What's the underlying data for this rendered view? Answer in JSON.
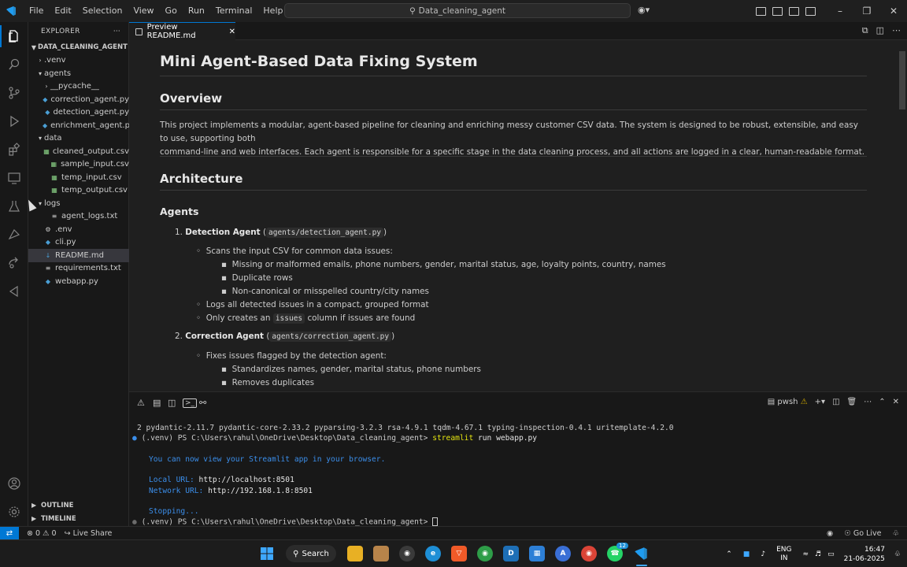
{
  "menu": [
    "File",
    "Edit",
    "Selection",
    "View",
    "Go",
    "Run",
    "Terminal",
    "Help"
  ],
  "search": {
    "text": "Data_cleaning_agent"
  },
  "explorer": {
    "header": "EXPLORER",
    "root": "DATA_CLEANING_AGENT",
    "items": [
      {
        "label": ".venv",
        "kind": "folder",
        "indent": 1,
        "open": false
      },
      {
        "label": "agents",
        "kind": "folder",
        "indent": 1,
        "open": true
      },
      {
        "label": "__pycache__",
        "kind": "folder",
        "indent": 2,
        "open": false
      },
      {
        "label": "correction_agent.py",
        "kind": "py",
        "indent": 2
      },
      {
        "label": "detection_agent.py",
        "kind": "py",
        "indent": 2
      },
      {
        "label": "enrichment_agent.py",
        "kind": "py",
        "indent": 2
      },
      {
        "label": "data",
        "kind": "folder",
        "indent": 1,
        "open": true
      },
      {
        "label": "cleaned_output.csv",
        "kind": "csv",
        "indent": 2
      },
      {
        "label": "sample_input.csv",
        "kind": "csv",
        "indent": 2
      },
      {
        "label": "temp_input.csv",
        "kind": "csv",
        "indent": 2
      },
      {
        "label": "temp_output.csv",
        "kind": "csv",
        "indent": 2
      },
      {
        "label": "logs",
        "kind": "folder",
        "indent": 1,
        "open": true
      },
      {
        "label": "agent_logs.txt",
        "kind": "txt",
        "indent": 2
      },
      {
        "label": ".env",
        "kind": "env",
        "indent": 1
      },
      {
        "label": "cli.py",
        "kind": "py",
        "indent": 1
      },
      {
        "label": "README.md",
        "kind": "md",
        "indent": 1,
        "selected": true
      },
      {
        "label": "requirements.txt",
        "kind": "txt",
        "indent": 1
      },
      {
        "label": "webapp.py",
        "kind": "py",
        "indent": 1
      }
    ],
    "outline": "OUTLINE",
    "timeline": "TIMELINE"
  },
  "tab": {
    "label": "Preview README.md"
  },
  "readme": {
    "title": "Mini Agent-Based Data Fixing System",
    "overview_heading": "Overview",
    "overview_line1": "This project implements a modular, agent-based pipeline for cleaning and enriching messy customer CSV data. The system is designed to be robust, extensible, and easy to use, supporting both",
    "overview_line2": "command-line and web interfaces. Each agent is responsible for a specific stage in the data cleaning process, and all actions are logged in a clear, human-readable format.",
    "architecture_heading": "Architecture",
    "agents_heading": "Agents",
    "a1_num": "1.",
    "a1_name": "Detection Agent",
    "a1_path": "agents/detection_agent.py",
    "a1_b1": "Scans the input CSV for common data issues:",
    "a1_b1_s1": "Missing or malformed emails, phone numbers, gender, marital status, age, loyalty points, country, names",
    "a1_b1_s2": "Duplicate rows",
    "a1_b1_s3": "Non-canonical or misspelled country/city names",
    "a1_b2": "Logs all detected issues in a compact, grouped format",
    "a1_b3_pre": "Only creates an",
    "a1_b3_code": "issues",
    "a1_b3_post": "column if issues are found",
    "a2_num": "2.",
    "a2_name": "Correction Agent",
    "a2_path": "agents/correction_agent.py",
    "a2_b1": "Fixes issues flagged by the detection agent:",
    "a2_b1_s1": "Standardizes names, gender, marital status, phone numbers",
    "a2_b1_s2": "Removes duplicates"
  },
  "terminal": {
    "shell": "pwsh",
    "line1": "2 pydantic-2.11.7 pydantic-core-2.33.2 pyparsing-3.2.3 rsa-4.9.1 tqdm-4.67.1 typing-inspection-0.4.1 uritemplate-4.2.0",
    "prompt": "(.venv) PS C:\\Users\\rahul\\OneDrive\\Desktop\\Data_cleaning_agent>",
    "cmd_main": "streamlit",
    "cmd_rest": "run webapp.py",
    "view_msg": "You can now view your Streamlit app in your browser.",
    "local_label": "Local URL:",
    "local_url": "http://localhost:8501",
    "network_label": "Network URL:",
    "network_url": "http://192.168.1.8:8501",
    "stopping": "Stopping..."
  },
  "status": {
    "errors": "0",
    "warnings": "0",
    "live_share": "Live Share",
    "go_live": "Go Live"
  },
  "taskbar": {
    "search": "Search",
    "lang_top": "ENG",
    "lang_bottom": "IN",
    "time": "16:47",
    "date": "21-06-2025",
    "badge_teams": "12"
  },
  "colors": {
    "accent": "#0078d4",
    "terminal_blue": "#3b8eea",
    "terminal_yellow": "#e5e510"
  }
}
